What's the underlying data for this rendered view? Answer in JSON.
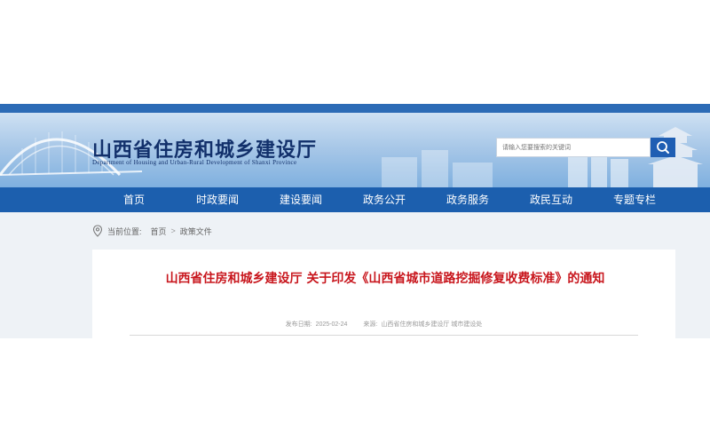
{
  "site": {
    "title": "山西省住房和城乡建设厅",
    "subtitle": "Department of Housing and Urban-Rural Development of Shanxi Province"
  },
  "search": {
    "placeholder": "请输入您要搜索的关键词",
    "button_icon": "search-icon"
  },
  "nav": {
    "items": [
      {
        "label": "首页"
      },
      {
        "label": "时政要闻"
      },
      {
        "label": "建设要闻"
      },
      {
        "label": "政务公开"
      },
      {
        "label": "政务服务"
      },
      {
        "label": "政民互动"
      },
      {
        "label": "专题专栏"
      }
    ]
  },
  "breadcrumb": {
    "prefix": "当前位置:",
    "home": "首页",
    "separator": ">",
    "current": "政策文件"
  },
  "article": {
    "title": "山西省住房和城乡建设厅 关于印发《山西省城市道路挖掘修复收费标准》的通知",
    "date_label": "发布日期:",
    "date": "2025-02-24",
    "source_label": "来源:",
    "source": "山西省住房和城乡建设厅 城市建设处"
  },
  "colors": {
    "nav_blue": "#1c5fae",
    "title_red": "#c8161d",
    "brand_navy": "#12306b"
  }
}
